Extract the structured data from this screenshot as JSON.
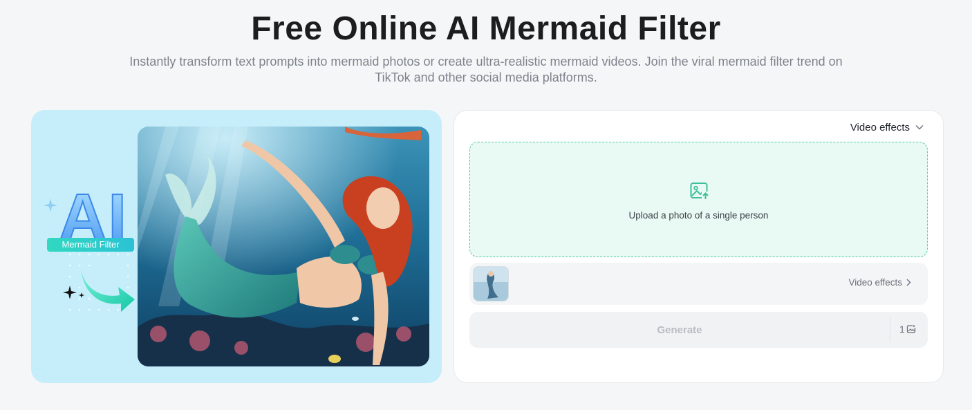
{
  "header": {
    "title": "Free Online AI Mermaid Filter",
    "subtitle": "Instantly transform text prompts into mermaid photos or create ultra-realistic mermaid videos. Join the viral mermaid filter trend on TikTok and other social media platforms."
  },
  "showcase": {
    "logo_letters": "AI",
    "logo_badge": "Mermaid Filter"
  },
  "panel": {
    "mode_dropdown": "Video effects",
    "upload_label": "Upload a photo of a single person",
    "effect_link": "Video effects",
    "generate_label": "Generate",
    "credit_count": "1"
  },
  "colors": {
    "accent": "#4fc9a4",
    "showcase_bg": "#c6eefa",
    "upload_bg": "#e8faf3"
  }
}
